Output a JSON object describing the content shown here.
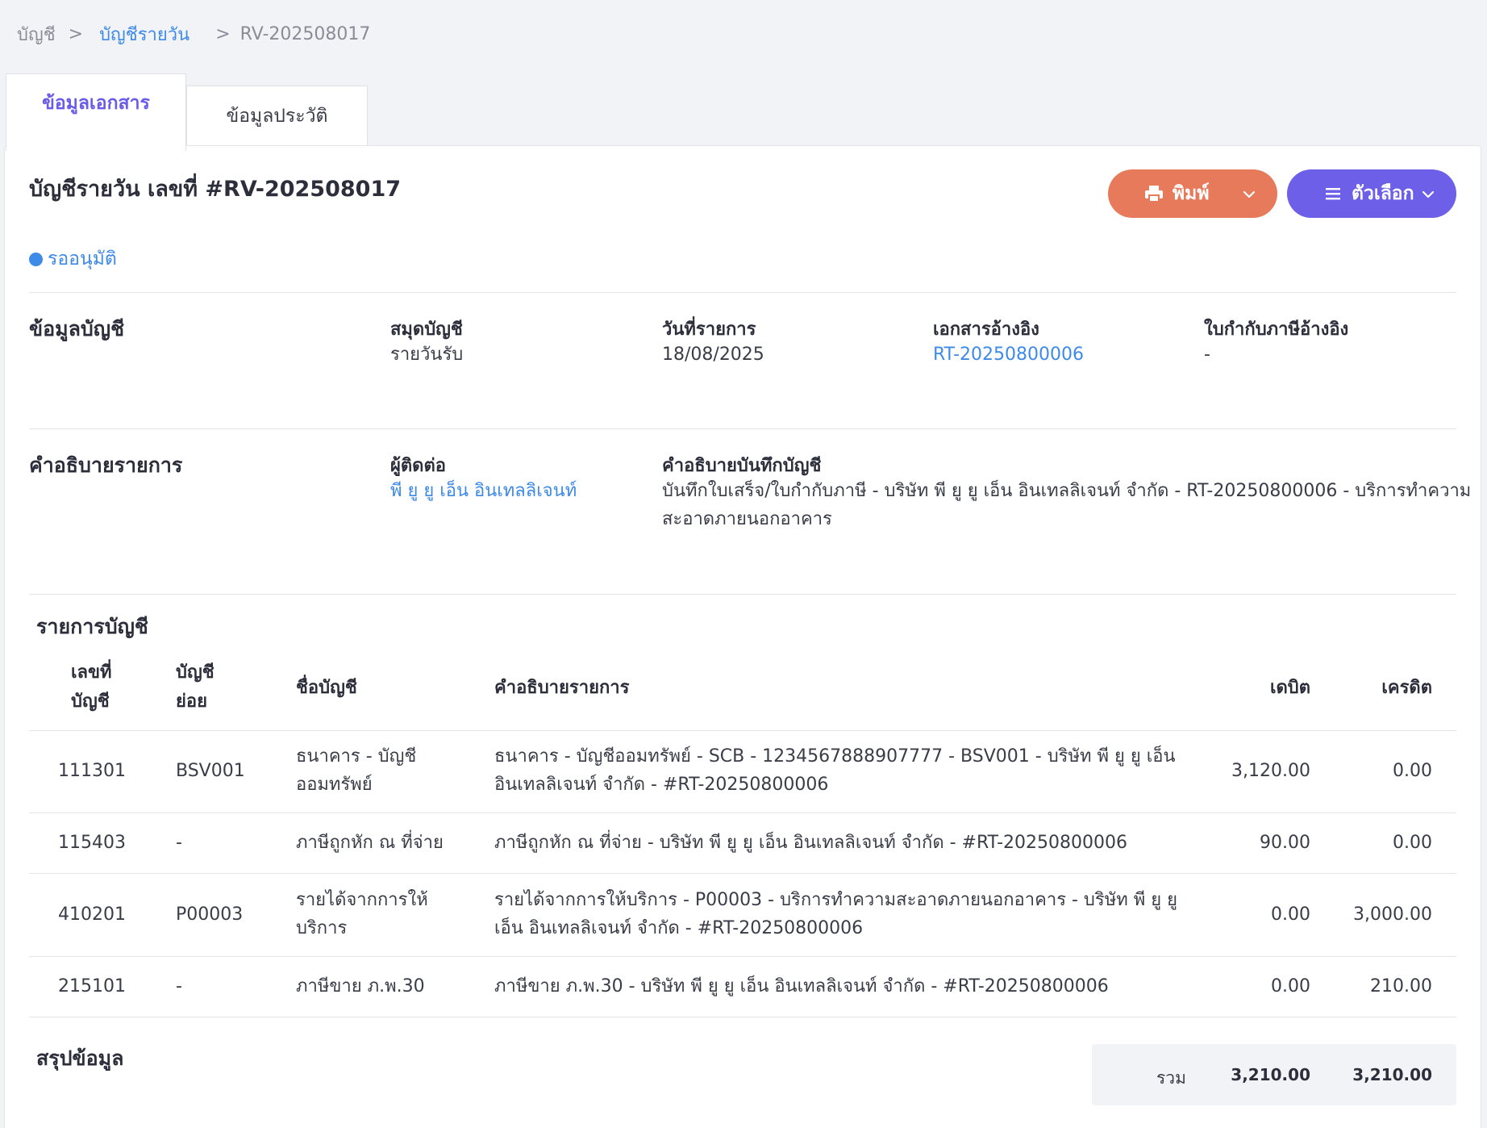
{
  "breadcrumb": {
    "root": "บัญชี",
    "sep1": ">",
    "parent": "บัญชีรายวัน",
    "sep2": ">",
    "current": "RV-202508017"
  },
  "tabs": [
    {
      "label": "ข้อมูลเอกสาร",
      "active": true
    },
    {
      "label": "ข้อมูลประวัติ",
      "active": false
    }
  ],
  "document": {
    "title": "บัญชีรายวัน เลขที่ #RV-202508017",
    "status": "รออนุมัติ",
    "status_color": "#3d8ae8"
  },
  "actions": {
    "print_label": "พิมพ์",
    "options_label": "ตัวเลือก",
    "print_color": "#e87a5c",
    "options_color": "#6d5fe8"
  },
  "account_info": {
    "section_title": "ข้อมูลบัญชี",
    "book_label": "สมุดบัญชี",
    "book_value": "รายวันรับ",
    "date_label": "วันที่รายการ",
    "date_value": "18/08/2025",
    "ref_doc_label": "เอกสารอ้างอิง",
    "ref_doc_value": "RT-20250800006",
    "tax_inv_label": "ใบกำกับภาษีอ้างอิง",
    "tax_inv_value": "-"
  },
  "description": {
    "section_title": "คำอธิบายรายการ",
    "contact_label": "ผู้ติดต่อ",
    "contact_value": "พี ยู ยู เอ็น อินเทลลิเจนท์",
    "memo_label": "คำอธิบายบันทึกบัญชี",
    "memo_line1": "บันทึกใบเสร็จ/ใบกำกับภาษี - บริษัท พี ยู ยู เอ็น อินเทลลิเจนท์ จำกัด - RT-20250800006 - บริการทำความ",
    "memo_line2": "สะอาดภายนอกอาคาร"
  },
  "ledger": {
    "section_title": "รายการบัญชี",
    "headers": {
      "account_no_1": "เลขที่",
      "account_no_2": "บัญชี",
      "sub_account_1": "บัญชี",
      "sub_account_2": "ย่อย",
      "account_name": "ชื่อบัญชี",
      "description": "คำอธิบายรายการ",
      "debit": "เดบิต",
      "credit": "เครดิต"
    },
    "rows": [
      {
        "account_no": "111301",
        "sub_account": "BSV001",
        "name_1": "ธนาคาร - บัญชี",
        "name_2": "ออมทรัพย์",
        "desc_1": "ธนาคาร - บัญชีออมทรัพย์ - SCB - 1234567888907777 - BSV001 - บริษัท พี ยู ยู เอ็น",
        "desc_2": "อินเทลลิเจนท์ จำกัด - #RT-20250800006",
        "debit": "3,120.00",
        "credit": "0.00"
      },
      {
        "account_no": "115403",
        "sub_account": "-",
        "name_1": "ภาษีถูกหัก ณ ที่จ่าย",
        "name_2": "",
        "desc_1": "ภาษีถูกหัก ณ ที่จ่าย - บริษัท พี ยู ยู เอ็น อินเทลลิเจนท์ จำกัด - #RT-20250800006",
        "desc_2": "",
        "debit": "90.00",
        "credit": "0.00"
      },
      {
        "account_no": "410201",
        "sub_account": "P00003",
        "name_1": "รายได้จากการให้",
        "name_2": "บริการ",
        "desc_1": "รายได้จากการให้บริการ - P00003 - บริการทำความสะอาดภายนอกอาคาร - บริษัท พี ยู ยู",
        "desc_2": "เอ็น อินเทลลิเจนท์ จำกัด - #RT-20250800006",
        "debit": "0.00",
        "credit": "3,000.00"
      },
      {
        "account_no": "215101",
        "sub_account": "-",
        "name_1": "ภาษีขาย ภ.พ.30",
        "name_2": "",
        "desc_1": "ภาษีขาย ภ.พ.30 - บริษัท พี ยู ยู เอ็น อินเทลลิเจนท์ จำกัด - #RT-20250800006",
        "desc_2": "",
        "debit": "0.00",
        "credit": "210.00"
      }
    ]
  },
  "summary": {
    "section_title": "สรุปข้อมูล",
    "total_label": "รวม",
    "total_debit": "3,210.00",
    "total_credit": "3,210.00"
  },
  "icons": {
    "print": "printer-icon",
    "options": "menu-icon",
    "dropdown": "chevron-down-icon"
  }
}
